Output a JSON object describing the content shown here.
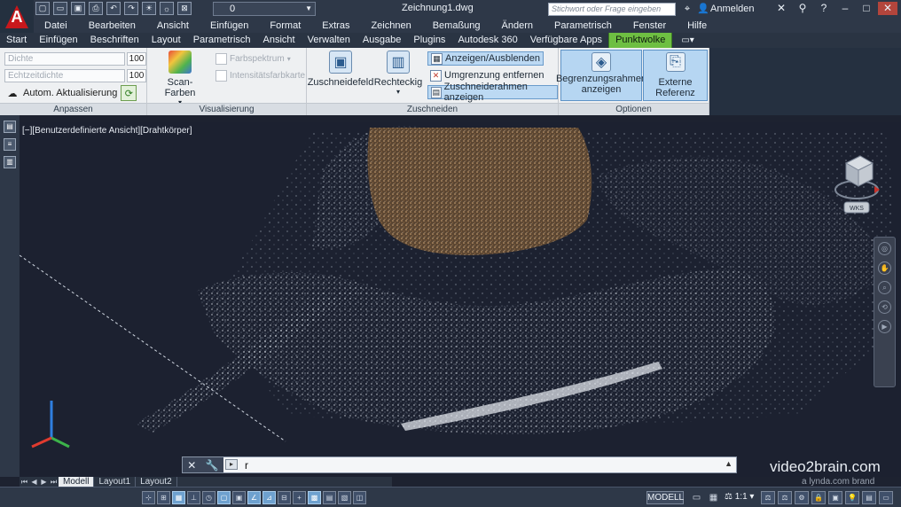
{
  "titlebar": {
    "layer_value": "0",
    "doc_title": "Zeichnung1.dwg",
    "search_placeholder": "Stichwort oder Frage eingeben",
    "signin": "Anmelden"
  },
  "menu": [
    "Datei",
    "Bearbeiten",
    "Ansicht",
    "Einfügen",
    "Format",
    "Extras",
    "Zeichnen",
    "Bemaßung",
    "Ändern",
    "Parametrisch",
    "Fenster",
    "Hilfe"
  ],
  "ribbon_tabs": [
    "Start",
    "Einfügen",
    "Beschriften",
    "Layout",
    "Parametrisch",
    "Ansicht",
    "Verwalten",
    "Ausgabe",
    "Plugins",
    "Autodesk 360",
    "Verfügbare Apps",
    "Punktwolke"
  ],
  "active_tab": "Punktwolke",
  "panels": {
    "anpassen": {
      "title": "Anpassen",
      "dichte_label": "Dichte",
      "dichte_value": "100",
      "echtzeitdichte_label": "Echtzeitdichte",
      "echtzeitdichte_value": "100",
      "auto_update": "Autom. Aktualisierung"
    },
    "visualisierung": {
      "title": "Visualisierung",
      "scan_farben": "Scan-Farben",
      "farbspektrum": "Farbspektrum",
      "intensitaetsfarbkarte": "Intensitätsfarbkarte"
    },
    "zuschneiden": {
      "title": "Zuschneiden",
      "zuschneidefeld": "Zuschneidefeld",
      "rechteckig": "Rechteckig",
      "anzeigen_ausblenden": "Anzeigen/Ausblenden",
      "umgrenzung_entfernen": "Umgrenzung entfernen",
      "zuschneiderahmen_anzeigen": "Zuschneiderahmen anzeigen"
    },
    "optionen": {
      "title": "Optionen",
      "begrenzungsrahmen_line1": "Begrenzungsrahmen",
      "begrenzungsrahmen_line2": "anzeigen",
      "externe_referenz": "Externe Referenz"
    }
  },
  "viewport": {
    "label": "[−][Benutzerdefinierte Ansicht][Drahtkörper]",
    "viewcube_label": "WKS"
  },
  "command": {
    "text": "r"
  },
  "watermark": {
    "brand": "video2brain.com",
    "sub": "a lynda.com brand"
  },
  "layout_tabs": [
    "Modell",
    "Layout1",
    "Layout2"
  ],
  "status": {
    "model": "MODELL",
    "scale": "1:1"
  },
  "colors": {
    "active_tab": "#6ebf42",
    "selected_button": "#b6d6f2",
    "autocad_red": "#c8181c",
    "viewport_bg": "#1c2130"
  }
}
